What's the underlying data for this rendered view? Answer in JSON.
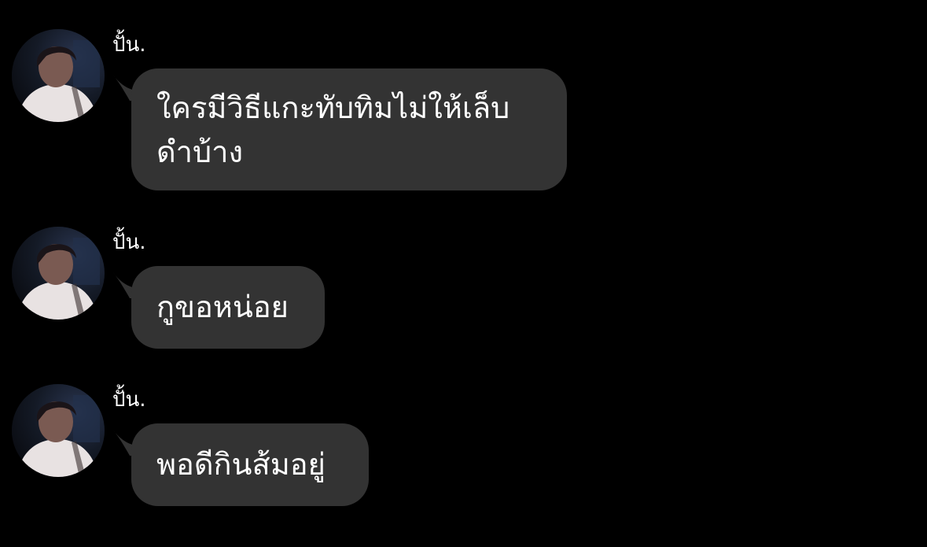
{
  "messages": [
    {
      "sender": "ปั้น.",
      "text": "ใครมีวิธีแกะทับทิมไม่ให้เล็บ\nดำบ้าง",
      "avatar_icon": "profile-photo"
    },
    {
      "sender": "ปั้น.",
      "text": "กูขอหน่อย",
      "avatar_icon": "profile-photo"
    },
    {
      "sender": "ปั้น.",
      "text": "พอดีกินส้มอยู่",
      "avatar_icon": "profile-photo"
    }
  ],
  "colors": {
    "background": "#000000",
    "bubble": "#333333",
    "text": "#ffffff"
  }
}
